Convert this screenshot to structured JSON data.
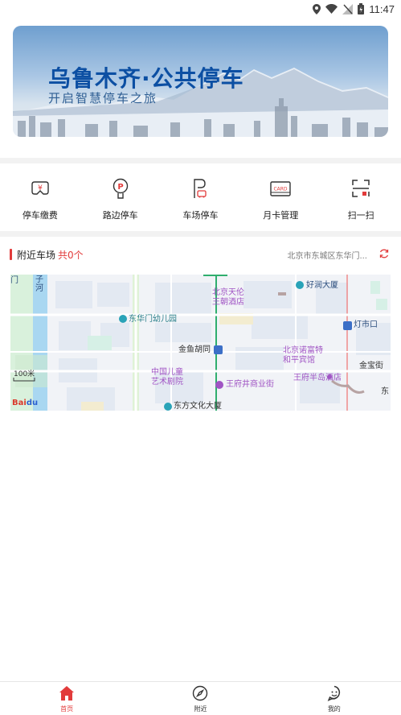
{
  "status_bar": {
    "time": "11:47"
  },
  "banner": {
    "title": "乌鲁木齐·公共停车",
    "subtitle": "开启智慧停车之旅"
  },
  "quick_menu": {
    "items": [
      {
        "label": "停车缴费",
        "icon": "parking-fee-icon"
      },
      {
        "label": "路边停车",
        "icon": "roadside-parking-icon"
      },
      {
        "label": "车场停车",
        "icon": "lot-parking-icon"
      },
      {
        "label": "月卡管理",
        "icon": "month-card-icon"
      },
      {
        "label": "扫一扫",
        "icon": "scan-icon"
      }
    ]
  },
  "nearby": {
    "title": "附近车场",
    "count": "共0个",
    "address": "北京市东城区东华门..."
  },
  "map": {
    "scale": "100米",
    "labels": {
      "tianlun": "北京天伦\n王朝酒店",
      "haorun": "好润大厦",
      "kindergarten": "东华门幼儿园",
      "dengshikou": "灯市口",
      "jinyu": "金鱼胡同",
      "nuofute": "北京诺富特\n和平宾馆",
      "jinbaojie": "金宝街",
      "children_theatre": "中国儿童\n艺术剧院",
      "wangfujing": "王府井商业街",
      "bandao": "王府半岛酒店",
      "dongfang": "东方文化大厦",
      "he": "河",
      "zi": "子",
      "men": "门",
      "dong": "东"
    }
  },
  "bottom_nav": {
    "items": [
      {
        "label": "首页",
        "icon": "home-icon",
        "active": true
      },
      {
        "label": "附近",
        "icon": "compass-icon",
        "active": false
      },
      {
        "label": "我的",
        "icon": "profile-icon",
        "active": false
      }
    ]
  }
}
